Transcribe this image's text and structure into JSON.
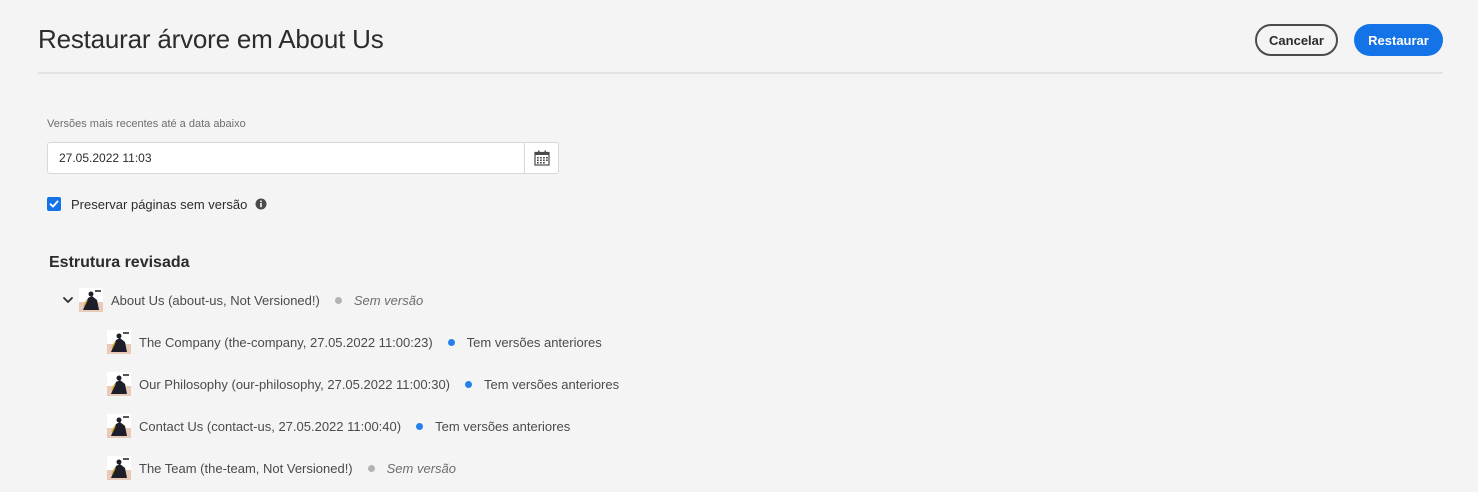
{
  "header": {
    "title": "Restaurar árvore em About Us",
    "cancel_label": "Cancelar",
    "restore_label": "Restaurar"
  },
  "form": {
    "date_label": "Versões mais recentes até a data abaixo",
    "date_value": "27.05.2022 11:03",
    "preserve_checked": true,
    "preserve_label": "Preservar páginas sem versão"
  },
  "tree": {
    "title": "Estrutura revisada",
    "root": {
      "label": "About Us (about-us, Not Versioned!)",
      "status": "Sem versão",
      "status_color": "#b3b3b3"
    },
    "children": [
      {
        "label": "The Company (the-company, 27.05.2022 11:00:23)",
        "status": "Tem versões anteriores",
        "status_color": "#2680eb"
      },
      {
        "label": "Our Philosophy (our-philosophy, 27.05.2022 11:00:30)",
        "status": "Tem versões anteriores",
        "status_color": "#2680eb"
      },
      {
        "label": "Contact Us (contact-us, 27.05.2022 11:00:40)",
        "status": "Tem versões anteriores",
        "status_color": "#2680eb"
      },
      {
        "label": "The Team (the-team, Not Versioned!)",
        "status": "Sem versão",
        "status_color": "#b3b3b3"
      }
    ]
  },
  "colors": {
    "accent": "#1473e6",
    "background": "#f4f4f4"
  },
  "icons": [
    "calendar-icon",
    "checkmark-icon",
    "info-icon",
    "chevron-down-icon",
    "page-thumbnail-icon"
  ]
}
